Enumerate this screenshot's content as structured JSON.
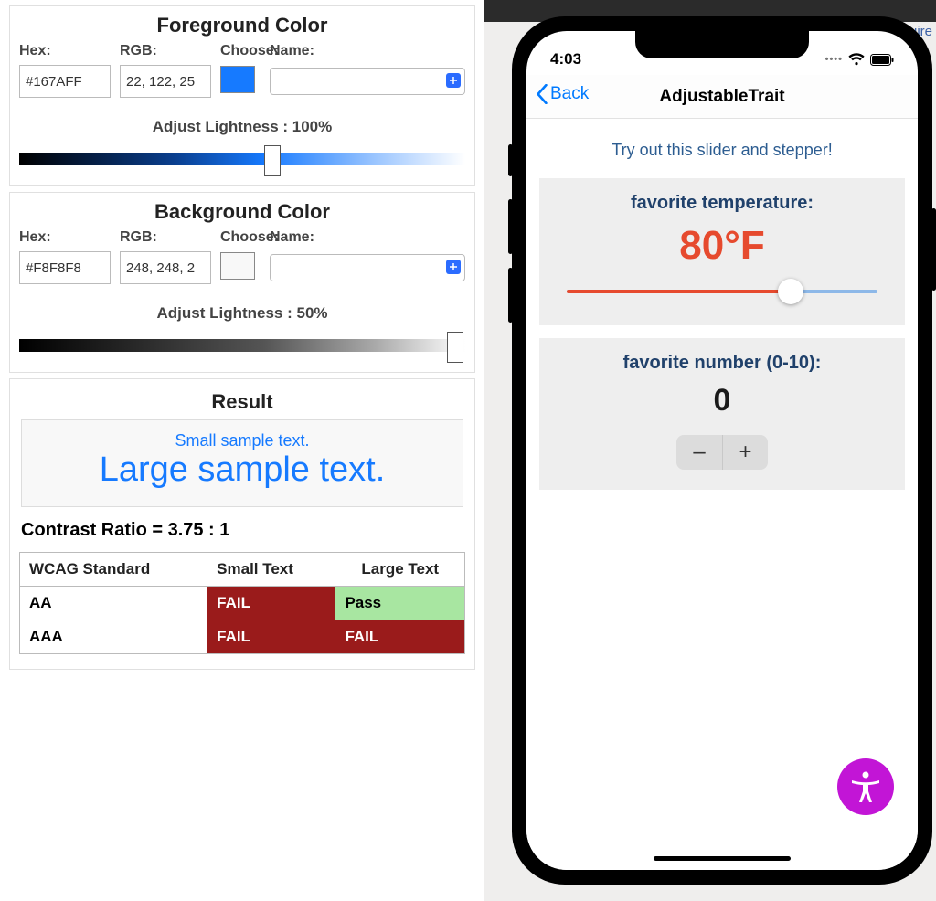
{
  "foreground": {
    "title": "Foreground Color",
    "labels": {
      "hex": "Hex:",
      "rgb": "RGB:",
      "choose": "Choose:",
      "name": "Name:"
    },
    "hex": "#167AFF",
    "rgb": "22, 122, 25",
    "swatch_color": "#167AFF",
    "lightness_label": "Adjust Lightness : 100%",
    "lightness_pct": 55
  },
  "background": {
    "title": "Background Color",
    "labels": {
      "hex": "Hex:",
      "rgb": "RGB:",
      "choose": "Choose:",
      "name": "Name:"
    },
    "hex": "#F8F8F8",
    "rgb": "248, 248, 2",
    "swatch_color": "#F8F8F8",
    "lightness_label": "Adjust Lightness : 50%",
    "lightness_pct": 96
  },
  "result": {
    "title": "Result",
    "small_sample": "Small sample text.",
    "large_sample": "Large sample text.",
    "ratio_label": "Contrast Ratio = 3.75 : 1",
    "headers": {
      "standard": "WCAG Standard",
      "small": "Small Text",
      "large": "Large Text"
    },
    "rows": [
      {
        "standard": "AA",
        "small": "FAIL",
        "large": "Pass"
      },
      {
        "standard": "AAA",
        "small": "FAIL",
        "large": "FAIL"
      }
    ]
  },
  "right_bg_link": "Color Contrast Require",
  "phone": {
    "status_time": "4:03",
    "nav_back": "Back",
    "nav_title": "AdjustableTrait",
    "intro": "Try out this slider and stepper!",
    "temp_card": {
      "title": "favorite temperature:",
      "value": "80°F",
      "slider_pct": 72
    },
    "num_card": {
      "title": "favorite number (0-10):",
      "value": "0",
      "minus": "–",
      "plus": "+"
    }
  }
}
